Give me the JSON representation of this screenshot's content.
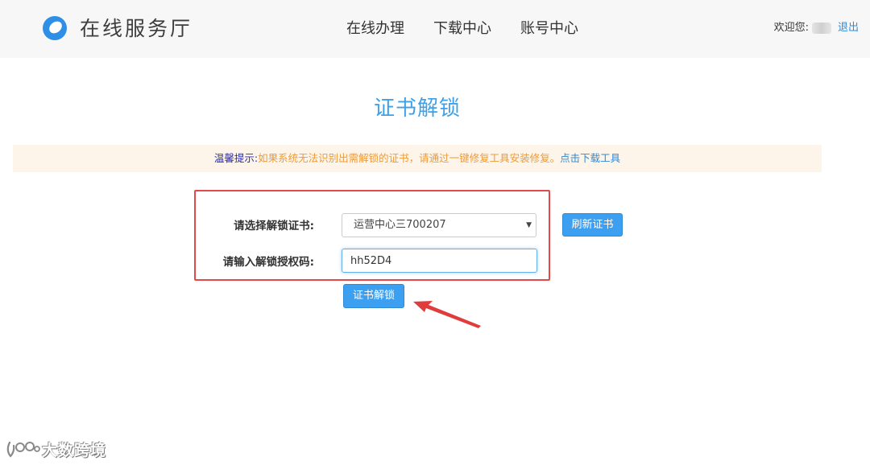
{
  "header": {
    "brand": "在线服务厅",
    "nav": [
      "在线办理",
      "下载中心",
      "账号中心"
    ],
    "welcome": "欢迎您:",
    "logout": "退出"
  },
  "main": {
    "title": "证书解锁",
    "notice": {
      "label": "温馨提示:",
      "text": "如果系统无法识别出需解锁的证书，请通过一键修复工具安装修复。",
      "link": "点击下载工具"
    },
    "form": {
      "cert_label": "请选择解锁证书:",
      "cert_value": "运营中心三700207",
      "code_label": "请输入解锁授权码:",
      "code_value": "hh52D4",
      "refresh_button": "刷新证书",
      "unlock_button": "证书解锁"
    }
  },
  "watermark": {
    "text": "大数跨境"
  },
  "icons": {
    "logo": "brand-logo-icon",
    "select_arrow": "caret-down-icon",
    "annotation": "red-arrow-icon",
    "watermark": "watermark-logo-icon"
  },
  "colors": {
    "accent": "#3c9ff0",
    "title": "#3ea0e8",
    "notice_bg": "#fdf5e9",
    "notice_text": "#ef9a36",
    "notice_label": "#2a2ab0",
    "link": "#2f8bd8",
    "highlight_frame": "#e24a4a"
  }
}
